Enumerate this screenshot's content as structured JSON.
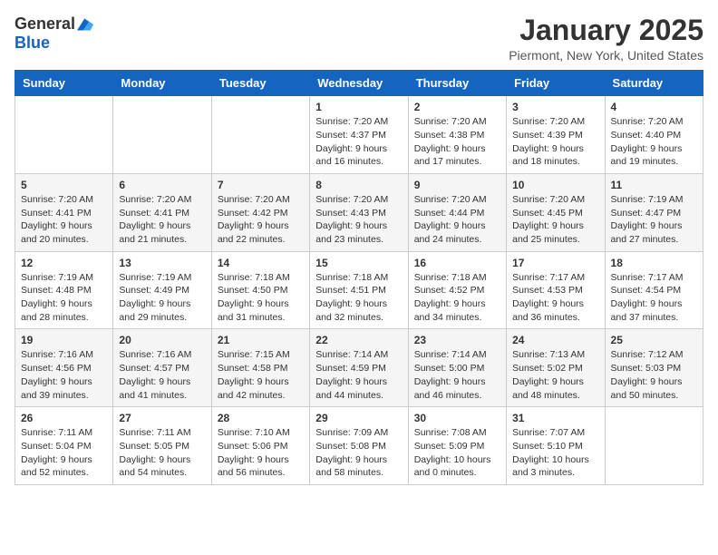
{
  "header": {
    "logo_general": "General",
    "logo_blue": "Blue",
    "title": "January 2025",
    "subtitle": "Piermont, New York, United States"
  },
  "days_of_week": [
    "Sunday",
    "Monday",
    "Tuesday",
    "Wednesday",
    "Thursday",
    "Friday",
    "Saturday"
  ],
  "weeks": [
    [
      {
        "day": "",
        "info": ""
      },
      {
        "day": "",
        "info": ""
      },
      {
        "day": "",
        "info": ""
      },
      {
        "day": "1",
        "info": "Sunrise: 7:20 AM\nSunset: 4:37 PM\nDaylight: 9 hours\nand 16 minutes."
      },
      {
        "day": "2",
        "info": "Sunrise: 7:20 AM\nSunset: 4:38 PM\nDaylight: 9 hours\nand 17 minutes."
      },
      {
        "day": "3",
        "info": "Sunrise: 7:20 AM\nSunset: 4:39 PM\nDaylight: 9 hours\nand 18 minutes."
      },
      {
        "day": "4",
        "info": "Sunrise: 7:20 AM\nSunset: 4:40 PM\nDaylight: 9 hours\nand 19 minutes."
      }
    ],
    [
      {
        "day": "5",
        "info": "Sunrise: 7:20 AM\nSunset: 4:41 PM\nDaylight: 9 hours\nand 20 minutes."
      },
      {
        "day": "6",
        "info": "Sunrise: 7:20 AM\nSunset: 4:41 PM\nDaylight: 9 hours\nand 21 minutes."
      },
      {
        "day": "7",
        "info": "Sunrise: 7:20 AM\nSunset: 4:42 PM\nDaylight: 9 hours\nand 22 minutes."
      },
      {
        "day": "8",
        "info": "Sunrise: 7:20 AM\nSunset: 4:43 PM\nDaylight: 9 hours\nand 23 minutes."
      },
      {
        "day": "9",
        "info": "Sunrise: 7:20 AM\nSunset: 4:44 PM\nDaylight: 9 hours\nand 24 minutes."
      },
      {
        "day": "10",
        "info": "Sunrise: 7:20 AM\nSunset: 4:45 PM\nDaylight: 9 hours\nand 25 minutes."
      },
      {
        "day": "11",
        "info": "Sunrise: 7:19 AM\nSunset: 4:47 PM\nDaylight: 9 hours\nand 27 minutes."
      }
    ],
    [
      {
        "day": "12",
        "info": "Sunrise: 7:19 AM\nSunset: 4:48 PM\nDaylight: 9 hours\nand 28 minutes."
      },
      {
        "day": "13",
        "info": "Sunrise: 7:19 AM\nSunset: 4:49 PM\nDaylight: 9 hours\nand 29 minutes."
      },
      {
        "day": "14",
        "info": "Sunrise: 7:18 AM\nSunset: 4:50 PM\nDaylight: 9 hours\nand 31 minutes."
      },
      {
        "day": "15",
        "info": "Sunrise: 7:18 AM\nSunset: 4:51 PM\nDaylight: 9 hours\nand 32 minutes."
      },
      {
        "day": "16",
        "info": "Sunrise: 7:18 AM\nSunset: 4:52 PM\nDaylight: 9 hours\nand 34 minutes."
      },
      {
        "day": "17",
        "info": "Sunrise: 7:17 AM\nSunset: 4:53 PM\nDaylight: 9 hours\nand 36 minutes."
      },
      {
        "day": "18",
        "info": "Sunrise: 7:17 AM\nSunset: 4:54 PM\nDaylight: 9 hours\nand 37 minutes."
      }
    ],
    [
      {
        "day": "19",
        "info": "Sunrise: 7:16 AM\nSunset: 4:56 PM\nDaylight: 9 hours\nand 39 minutes."
      },
      {
        "day": "20",
        "info": "Sunrise: 7:16 AM\nSunset: 4:57 PM\nDaylight: 9 hours\nand 41 minutes."
      },
      {
        "day": "21",
        "info": "Sunrise: 7:15 AM\nSunset: 4:58 PM\nDaylight: 9 hours\nand 42 minutes."
      },
      {
        "day": "22",
        "info": "Sunrise: 7:14 AM\nSunset: 4:59 PM\nDaylight: 9 hours\nand 44 minutes."
      },
      {
        "day": "23",
        "info": "Sunrise: 7:14 AM\nSunset: 5:00 PM\nDaylight: 9 hours\nand 46 minutes."
      },
      {
        "day": "24",
        "info": "Sunrise: 7:13 AM\nSunset: 5:02 PM\nDaylight: 9 hours\nand 48 minutes."
      },
      {
        "day": "25",
        "info": "Sunrise: 7:12 AM\nSunset: 5:03 PM\nDaylight: 9 hours\nand 50 minutes."
      }
    ],
    [
      {
        "day": "26",
        "info": "Sunrise: 7:11 AM\nSunset: 5:04 PM\nDaylight: 9 hours\nand 52 minutes."
      },
      {
        "day": "27",
        "info": "Sunrise: 7:11 AM\nSunset: 5:05 PM\nDaylight: 9 hours\nand 54 minutes."
      },
      {
        "day": "28",
        "info": "Sunrise: 7:10 AM\nSunset: 5:06 PM\nDaylight: 9 hours\nand 56 minutes."
      },
      {
        "day": "29",
        "info": "Sunrise: 7:09 AM\nSunset: 5:08 PM\nDaylight: 9 hours\nand 58 minutes."
      },
      {
        "day": "30",
        "info": "Sunrise: 7:08 AM\nSunset: 5:09 PM\nDaylight: 10 hours\nand 0 minutes."
      },
      {
        "day": "31",
        "info": "Sunrise: 7:07 AM\nSunset: 5:10 PM\nDaylight: 10 hours\nand 3 minutes."
      },
      {
        "day": "",
        "info": ""
      }
    ]
  ]
}
